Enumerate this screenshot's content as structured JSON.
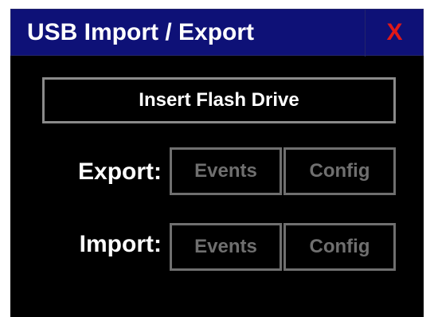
{
  "dialog": {
    "title": "USB Import / Export",
    "close_label": "X",
    "close_icon": "close-icon"
  },
  "status": {
    "message": "Insert Flash Drive"
  },
  "export": {
    "label": "Export:",
    "events_label": "Events",
    "config_label": "Config",
    "enabled": false
  },
  "import": {
    "label": "Import:",
    "events_label": "Events",
    "config_label": "Config",
    "enabled": false
  },
  "colors": {
    "titlebar": "#0e1177",
    "background": "#000000",
    "close": "#e01818",
    "disabled_text": "#6f6f6f",
    "border": "#8a8a8a"
  }
}
